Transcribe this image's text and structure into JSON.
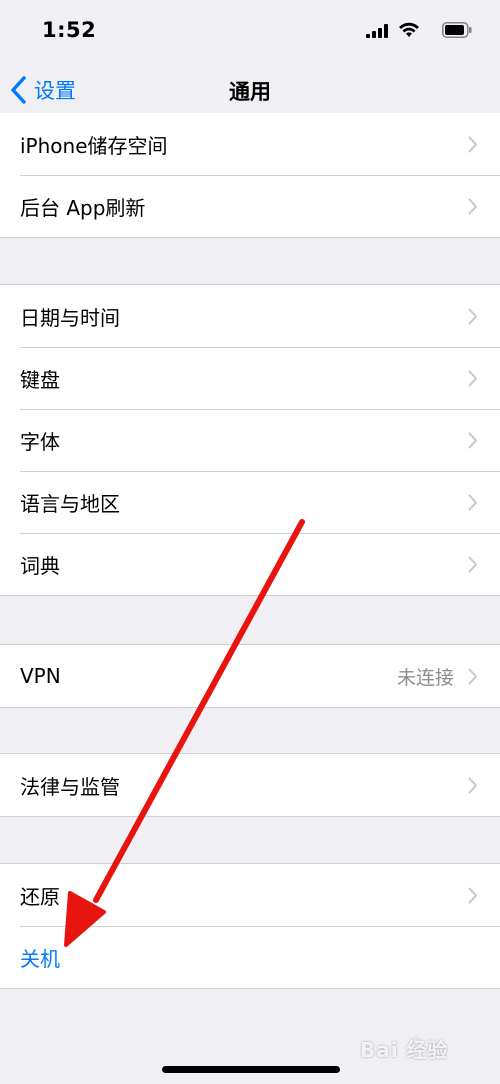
{
  "status_bar": {
    "time": "1:52",
    "icons": [
      "cellular-signal-icon",
      "wifi-icon",
      "battery-icon"
    ]
  },
  "nav": {
    "back_label": "设置",
    "title": "通用"
  },
  "groups": [
    {
      "rows": [
        {
          "label": "iPhone储存空间",
          "chevron": true
        },
        {
          "label": "后台 App刷新",
          "chevron": true
        }
      ]
    },
    {
      "rows": [
        {
          "label": "日期与时间",
          "chevron": true
        },
        {
          "label": "键盘",
          "chevron": true
        },
        {
          "label": "字体",
          "chevron": true
        },
        {
          "label": "语言与地区",
          "chevron": true
        },
        {
          "label": "词典",
          "chevron": true
        }
      ]
    },
    {
      "rows": [
        {
          "label": "VPN",
          "value": "未连接",
          "chevron": true
        }
      ]
    },
    {
      "rows": [
        {
          "label": "法律与监管",
          "chevron": true
        }
      ]
    },
    {
      "rows": [
        {
          "label": "还原",
          "chevron": true
        },
        {
          "label": "关机",
          "chevron": false,
          "style": "blue"
        }
      ]
    }
  ],
  "annotation": {
    "type": "arrow",
    "color": "#e8140f",
    "points_to": "关机"
  },
  "watermark": {
    "text": "Bai 经验"
  },
  "colors": {
    "accent": "#007aff",
    "background": "#efeff4",
    "secondary_text": "#8e8e93"
  }
}
